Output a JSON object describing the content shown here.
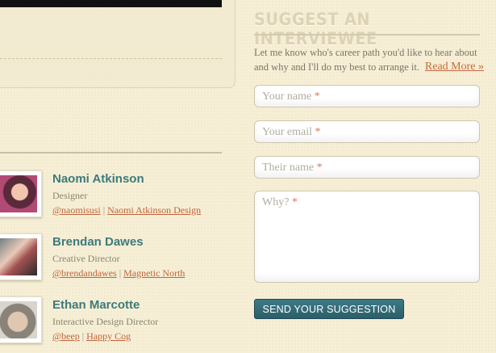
{
  "post": {
    "read_more": "Read More »"
  },
  "people": [
    {
      "name": "Naomi Atkinson",
      "role": "Designer",
      "twitter": "@naomisusi",
      "company": "Naomi Atkinson Design"
    },
    {
      "name": "Brendan Dawes",
      "role": "Creative Director",
      "twitter": "@brendandawes",
      "company": "Magnetic North"
    },
    {
      "name": "Ethan Marcotte",
      "role": "Interactive Design Director",
      "twitter": "@beep",
      "company": "Happy Cog"
    }
  ],
  "link_separator": "|",
  "suggest": {
    "title": "SUGGEST AN INTERVIEWEE",
    "intro": "Let me know who's career path you'd like to hear about and why and I'll do my best to arrange it.",
    "fields": {
      "your_name": "Your name",
      "your_email": "Your email",
      "their_name": "Their name",
      "why": "Why?"
    },
    "required_marker": "*",
    "submit": "SEND YOUR SUGGESTION"
  },
  "colors": {
    "accent_teal": "#3d7a7c",
    "link": "#c0643a",
    "button": "#2b5e69"
  }
}
